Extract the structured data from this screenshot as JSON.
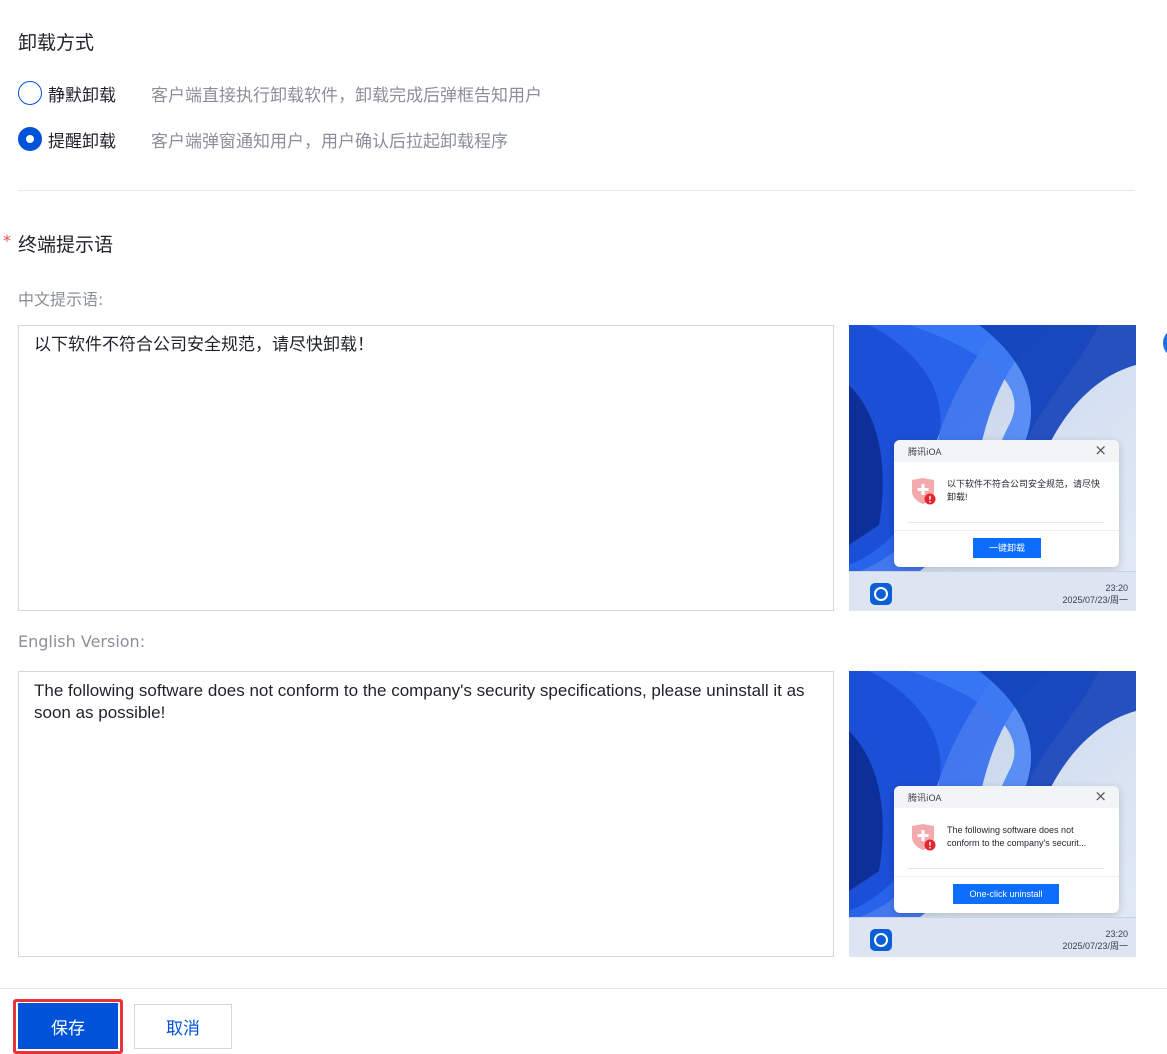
{
  "uninstall_method": {
    "title": "卸载方式",
    "options": [
      {
        "label": "静默卸载",
        "description": "客户端直接执行卸载软件，卸载完成后弹框告知用户",
        "selected": false
      },
      {
        "label": "提醒卸载",
        "description": "客户端弹窗通知用户，用户确认后拉起卸载程序",
        "selected": true
      }
    ]
  },
  "terminal_prompt": {
    "required_mark": "*",
    "title": "终端提示语",
    "chinese": {
      "label": "中文提示语:",
      "value": "以下软件不符合公司安全规范，请尽快卸载！",
      "preview": {
        "dialog_title": "腾讯iOA",
        "message": "以下软件不符合公司安全规范，请尽快卸载!",
        "button": "一键卸载",
        "time": "23:20",
        "date": "2025/07/23/周一"
      }
    },
    "english": {
      "label": "English Version:",
      "value": "The following software does not conform to the company's security specifications, please uninstall it as soon as possible!",
      "preview": {
        "dialog_title": "腾讯iOA",
        "message": "The following software does not conform to the company's securit...",
        "button": "One-click uninstall",
        "time": "23:20",
        "date": "2025/07/23/周一"
      }
    }
  },
  "footer": {
    "save_label": "保存",
    "cancel_label": "取消"
  },
  "colors": {
    "primary": "#0052d9",
    "required": "#e34d59",
    "highlight": "#e8323c",
    "dialog_button": "#0d6efd"
  },
  "icons": [
    "close-icon",
    "shield-warning-icon",
    "ioa-taskbar-icon"
  ]
}
